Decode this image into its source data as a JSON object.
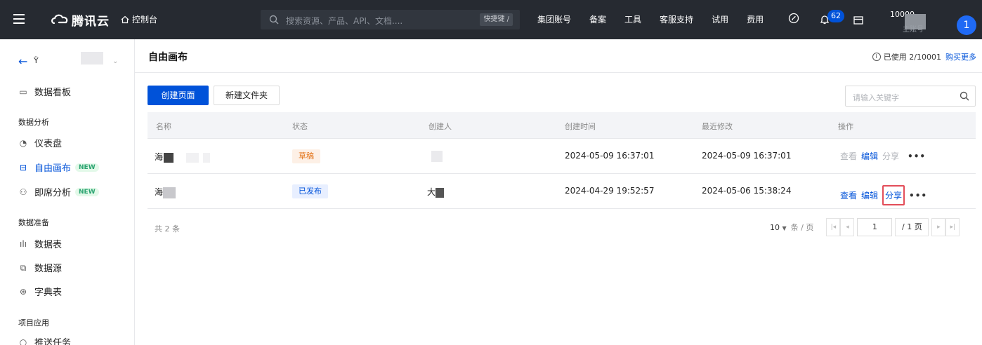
{
  "topbar": {
    "brand": "腾讯云",
    "console": "控制台",
    "search_placeholder": "搜索资源、产品、API、文档....",
    "shortcut": "快捷键 /",
    "links": [
      "集团账号",
      "备案",
      "工具",
      "客服支持",
      "试用",
      "费用"
    ],
    "notification_count": "62",
    "account_id": "10000",
    "account_sub": "主账号",
    "avatar": "1"
  },
  "sidebar": {
    "project_name": "Ÿ",
    "items": [
      {
        "label": "数据看板",
        "icon": "dashboard-icon"
      },
      {
        "label": "仪表盘",
        "icon": "gauge-icon"
      },
      {
        "label": "自由画布",
        "icon": "canvas-icon",
        "tag": "NEW",
        "active": true
      },
      {
        "label": "即席分析",
        "icon": "adhoc-icon",
        "tag": "NEW"
      },
      {
        "label": "数据表",
        "icon": "bar-icon"
      },
      {
        "label": "数据源",
        "icon": "datasource-icon"
      },
      {
        "label": "字典表",
        "icon": "dictionary-icon"
      },
      {
        "label": "推送任务",
        "icon": "push-icon"
      }
    ],
    "groups": [
      "数据分析",
      "数据准备",
      "项目应用"
    ]
  },
  "header": {
    "title": "自由画布",
    "usage": "已使用 2/10001",
    "buy_more": "购买更多"
  },
  "toolbar": {
    "create_page": "创建页面",
    "new_folder": "新建文件夹",
    "keyword_placeholder": "请输入关键字"
  },
  "table": {
    "columns": [
      "名称",
      "状态",
      "创建人",
      "创建时间",
      "最近修改",
      "操作"
    ],
    "rows": [
      {
        "name": "海",
        "status": "草稿",
        "creator": "",
        "created": "2024-05-09 16:37:01",
        "modified": "2024-05-09 16:37:01"
      },
      {
        "name": "海",
        "status": "已发布",
        "creator": "大",
        "created": "2024-04-29 19:52:57",
        "modified": "2024-05-06 15:38:24"
      }
    ],
    "ops": {
      "view": "查看",
      "edit": "编辑",
      "share": "分享",
      "more": "•••"
    }
  },
  "pagination": {
    "total": "共 2 条",
    "page_size": "10",
    "size_unit": "条 / 页",
    "current": "1",
    "total_pages": "/ 1 页"
  }
}
